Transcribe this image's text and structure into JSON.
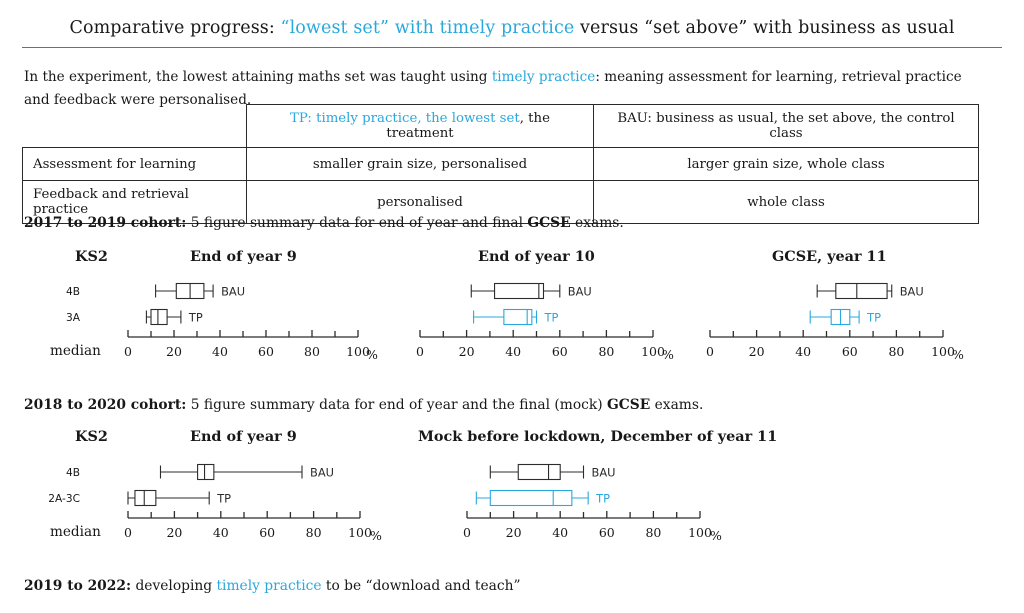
{
  "accent_color": "#29a8dd",
  "ink_color": "#181818",
  "title": {
    "part1": "Comparative progress:",
    "highlight": "“lowest set” with timely practice",
    "part2": "versus “set above” with business as usual"
  },
  "intro": {
    "before": "In the experiment, the lowest attaining maths set was taught using ",
    "highlight": "timely practice",
    "after": ": meaning assessment for learning, retrieval practice and feedback were personalised."
  },
  "table": {
    "header_tp_highlight": "TP: timely practice, the lowest set",
    "header_tp_rest": ", the treatment",
    "header_bau": "BAU: business as usual, the set above, the control class",
    "rows": [
      {
        "label": "Assessment for learning",
        "tp": "smaller grain size, personalised",
        "bau": "larger grain size, whole class"
      },
      {
        "label": "Feedback and retrieval practice",
        "tp": "personalised",
        "bau": "whole class"
      }
    ]
  },
  "cohort1": {
    "bold": "2017 to 2019 cohort:",
    "text_a": " 5 figure summary data for end of year and final ",
    "bold2": "GCSE",
    "text_b": " exams.",
    "ks2_label": "KS2",
    "column_headings": [
      "End of year 9",
      "End of year 10",
      "GCSE, year 11"
    ],
    "median_label": "median",
    "row_labels": [
      "4B",
      "3A"
    ]
  },
  "cohort2": {
    "bold": "2018 to 2020 cohort:",
    "text_a": " 5 figure summary data for end of year and the final (mock) ",
    "bold2": "GCSE",
    "text_b": " exams.",
    "ks2_label": "KS2",
    "column_headings": [
      "End of year 9",
      "Mock before lockdown, December of year 11"
    ],
    "median_label": "median",
    "row_labels": [
      "4B",
      "2A-3C"
    ]
  },
  "footer": {
    "bold": "2019 to 2022:",
    "text_a": "  developing ",
    "highlight": "timely practice",
    "text_b": " to be “download and teach”"
  },
  "axis": {
    "ticks_major": [
      0,
      20,
      40,
      60,
      80,
      100
    ],
    "tick_labels": [
      "0",
      "20",
      "40",
      "60",
      "80",
      "100"
    ],
    "minor_step": 10,
    "unit": "%",
    "min": 0,
    "max": 100
  },
  "chart_data": [
    {
      "type": "box",
      "id": "c1-year9",
      "title": "End of year 9",
      "cohort": "2017 to 2019",
      "xlabel": "median",
      "unit": "%",
      "xlim": [
        0,
        100
      ],
      "series": [
        {
          "name": "BAU",
          "row_label": "4B",
          "color": "#2c2c2c",
          "min": 12,
          "q1": 21,
          "median": 27,
          "q3": 33,
          "max": 37
        },
        {
          "name": "TP",
          "row_label": "3A",
          "color": "#2c2c2c",
          "min": 8,
          "q1": 10,
          "median": 13,
          "q3": 17,
          "max": 23
        }
      ]
    },
    {
      "type": "box",
      "id": "c1-year10",
      "title": "End of year 10",
      "cohort": "2017 to 2019",
      "xlabel": "",
      "unit": "%",
      "xlim": [
        0,
        100
      ],
      "series": [
        {
          "name": "BAU",
          "row_label": "4B",
          "color": "#2c2c2c",
          "min": 22,
          "q1": 32,
          "median": 51,
          "q3": 53,
          "max": 60
        },
        {
          "name": "TP",
          "row_label": "3A",
          "color": "#29a8dd",
          "min": 23,
          "q1": 36,
          "median": 46,
          "q3": 48,
          "max": 50
        }
      ]
    },
    {
      "type": "box",
      "id": "c1-gcse",
      "title": "GCSE, year 11",
      "cohort": "2017 to 2019",
      "xlabel": "",
      "unit": "%",
      "xlim": [
        0,
        100
      ],
      "series": [
        {
          "name": "BAU",
          "row_label": "4B",
          "color": "#2c2c2c",
          "min": 46,
          "q1": 54,
          "median": 63,
          "q3": 76,
          "max": 78
        },
        {
          "name": "TP",
          "row_label": "3A",
          "color": "#29a8dd",
          "min": 43,
          "q1": 52,
          "median": 56,
          "q3": 60,
          "max": 64
        }
      ]
    },
    {
      "type": "box",
      "id": "c2-year9",
      "title": "End of year 9",
      "cohort": "2018 to 2020",
      "xlabel": "median",
      "unit": "%",
      "xlim": [
        0,
        100
      ],
      "series": [
        {
          "name": "BAU",
          "row_label": "4B",
          "color": "#2c2c2c",
          "min": 14,
          "q1": 30,
          "median": 33,
          "q3": 37,
          "max": 75
        },
        {
          "name": "TP",
          "row_label": "2A-3C",
          "color": "#2c2c2c",
          "min": 0,
          "q1": 3,
          "median": 7,
          "q3": 12,
          "max": 35
        }
      ]
    },
    {
      "type": "box",
      "id": "c2-mock",
      "title": "Mock before lockdown, December of year 11",
      "cohort": "2018 to 2020",
      "xlabel": "",
      "unit": "%",
      "xlim": [
        0,
        100
      ],
      "series": [
        {
          "name": "BAU",
          "row_label": "4B",
          "color": "#2c2c2c",
          "min": 10,
          "q1": 22,
          "median": 35,
          "q3": 40,
          "max": 50
        },
        {
          "name": "TP",
          "row_label": "2A-3C",
          "color": "#29a8dd",
          "min": 4,
          "q1": 10,
          "median": 37,
          "q3": 45,
          "max": 52
        }
      ]
    }
  ]
}
